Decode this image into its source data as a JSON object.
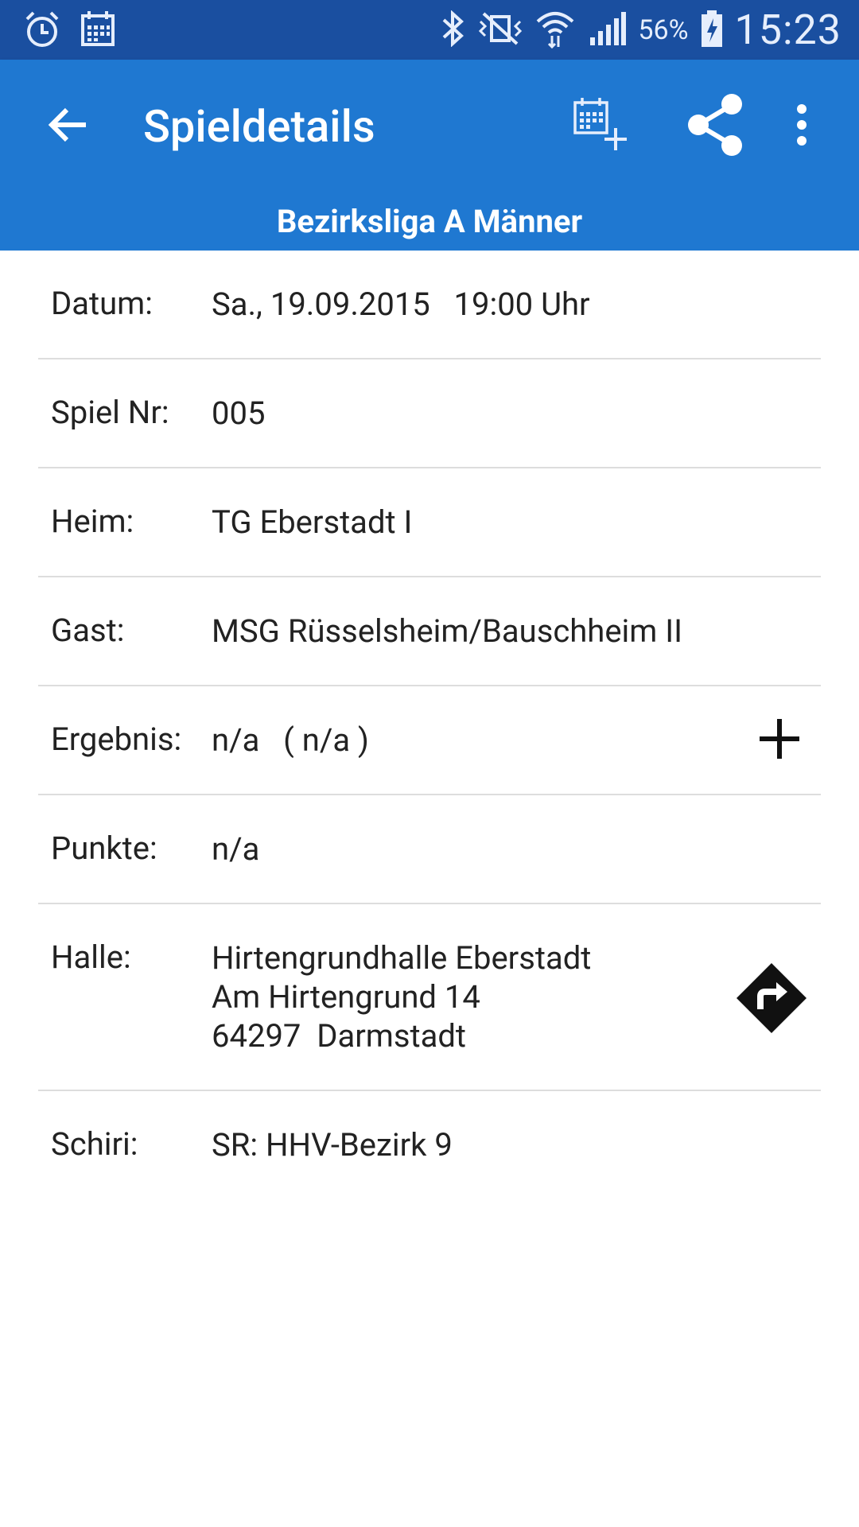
{
  "status_bar": {
    "battery_percent": "56%",
    "time": "15:23",
    "icons_left": [
      "alarm-clock-icon",
      "calendar-icon"
    ],
    "icons_right": [
      "bluetooth-icon",
      "vibrate-mute-icon",
      "wifi-icon",
      "cell-signal-icon",
      "battery-charging-icon"
    ]
  },
  "app_bar": {
    "title": "Spieldetails",
    "actions": [
      "back-arrow-icon",
      "calendar-add-icon",
      "share-icon",
      "overflow-menu-icon"
    ],
    "color": "#1f78d1"
  },
  "league": "Bezirksliga A Männer",
  "details": {
    "datum_label": "Datum:",
    "datum_value": "Sa., 19.09.2015   19:00 Uhr",
    "spielnr_label": "Spiel Nr:",
    "spielnr_value": "005",
    "heim_label": "Heim:",
    "heim_value": "TG Eberstadt I",
    "gast_label": "Gast:",
    "gast_value": "MSG Rüsselsheim/Bauschheim II",
    "ergebnis_label": "Ergebnis:",
    "ergebnis_value": "n/a   ( n/a )",
    "punkte_label": "Punkte:",
    "punkte_value": "n/a",
    "halle_label": "Halle:",
    "halle_line1": "Hirtengrundhalle Eberstadt",
    "halle_line2": "Am Hirtengrund 14",
    "halle_line3": "64297  Darmstadt",
    "schiri_label": "Schiri:",
    "schiri_value": "SR: HHV-Bezirk 9"
  }
}
